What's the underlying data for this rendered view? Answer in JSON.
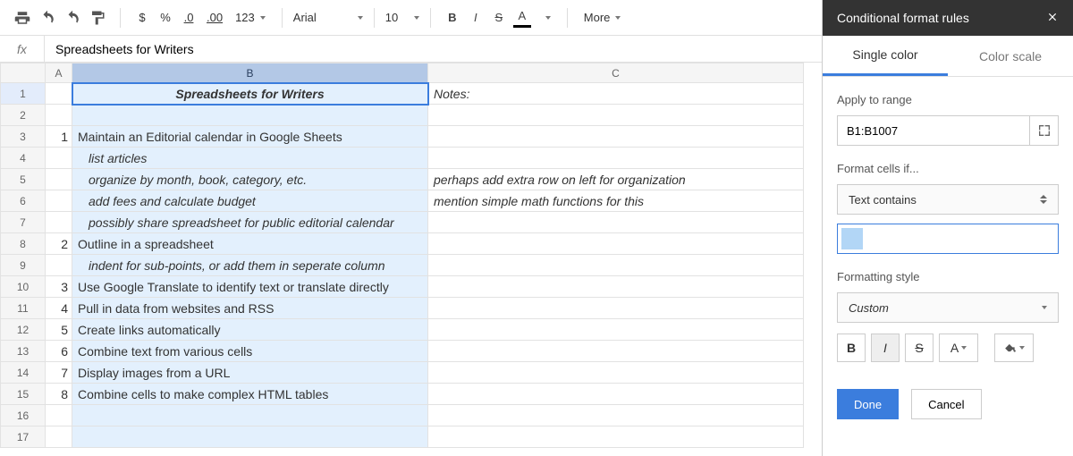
{
  "toolbar": {
    "currency": "$",
    "percent": "%",
    "dec_dec": ".0",
    "dec_inc": ".00",
    "num_fmt": "123",
    "font": "Arial",
    "size": "10",
    "bold": "B",
    "italic": "I",
    "strike": "S",
    "textcolor": "A",
    "more": "More"
  },
  "formula_bar": {
    "fx": "fx",
    "value": "Spreadsheets for Writers"
  },
  "columns": {
    "A": "A",
    "B": "B",
    "C": "C"
  },
  "rows": [
    {
      "n": "1",
      "a": "",
      "b": "Spreadsheets for Writers",
      "b_style": "title",
      "c": "Notes:"
    },
    {
      "n": "2",
      "a": "",
      "b": "",
      "c": ""
    },
    {
      "n": "3",
      "a": "1",
      "b": "Maintain an Editorial calendar in Google Sheets",
      "c": ""
    },
    {
      "n": "4",
      "a": "",
      "b": "list articles",
      "b_style": "sub",
      "c": ""
    },
    {
      "n": "5",
      "a": "",
      "b": "organize by month, book, category, etc.",
      "b_style": "sub",
      "c": "perhaps add extra row on left for organization"
    },
    {
      "n": "6",
      "a": "",
      "b": "add fees and calculate budget",
      "b_style": "sub",
      "c": "mention simple math functions for this"
    },
    {
      "n": "7",
      "a": "",
      "b": "possibly share spreadsheet for public editorial calendar",
      "b_style": "sub",
      "c": ""
    },
    {
      "n": "8",
      "a": "2",
      "b": "Outline in a spreadsheet",
      "c": ""
    },
    {
      "n": "9",
      "a": "",
      "b": "indent for sub-points, or add them in seperate column",
      "b_style": "sub",
      "c": ""
    },
    {
      "n": "10",
      "a": "3",
      "b": "Use Google Translate to identify text or translate directly",
      "c": ""
    },
    {
      "n": "11",
      "a": "4",
      "b": "Pull in data from websites and RSS",
      "c": ""
    },
    {
      "n": "12",
      "a": "5",
      "b": "Create links automatically",
      "c": ""
    },
    {
      "n": "13",
      "a": "6",
      "b": "Combine text from various cells",
      "c": ""
    },
    {
      "n": "14",
      "a": "7",
      "b": "Display images from a URL",
      "c": ""
    },
    {
      "n": "15",
      "a": "8",
      "b": "Combine cells to make complex HTML tables",
      "c": ""
    },
    {
      "n": "16",
      "a": "",
      "b": "",
      "c": ""
    },
    {
      "n": "17",
      "a": "",
      "b": "",
      "c": ""
    }
  ],
  "sidebar": {
    "title": "Conditional format rules",
    "tab_single": "Single color",
    "tab_scale": "Color scale",
    "apply_label": "Apply to range",
    "range_value": "B1:B1007",
    "format_if_label": "Format cells if...",
    "condition": "Text contains",
    "style_label": "Formatting style",
    "style_value": "Custom",
    "done": "Done",
    "cancel": "Cancel"
  }
}
